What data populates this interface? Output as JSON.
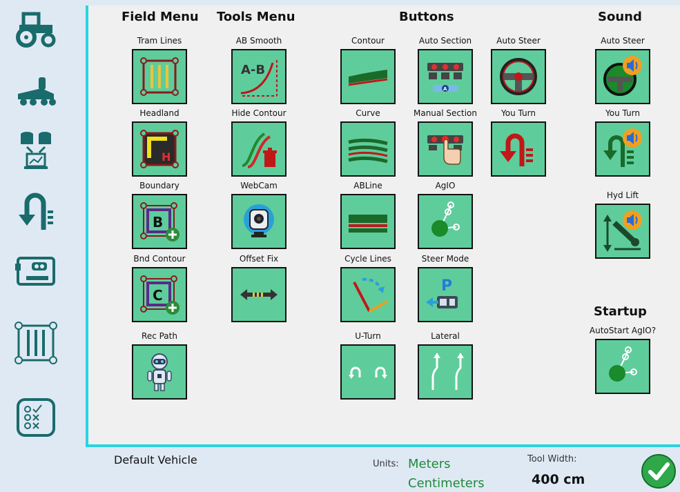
{
  "sidebar": {
    "items": [
      {
        "name": "vehicle"
      },
      {
        "name": "tool"
      },
      {
        "name": "data-sources"
      },
      {
        "name": "u-turn"
      },
      {
        "name": "arduino"
      },
      {
        "name": "tram"
      },
      {
        "name": "features"
      }
    ]
  },
  "sections": {
    "field_menu": "Field Menu",
    "tools_menu": "Tools Menu",
    "buttons": "Buttons",
    "sound": "Sound",
    "startup": "Startup"
  },
  "field_menu": {
    "tram_lines": "Tram Lines",
    "headland": "Headland",
    "boundary": "Boundary",
    "bnd_contour": "Bnd Contour",
    "rec_path": "Rec Path"
  },
  "tools_menu": {
    "ab_smooth": "AB Smooth",
    "hide_contour": "Hide Contour",
    "webcam": "WebCam",
    "offset_fix": "Offset Fix"
  },
  "buttons": {
    "contour": "Contour",
    "auto_section": "Auto Section",
    "auto_steer": "Auto Steer",
    "curve": "Curve",
    "manual_section": "Manual Section",
    "you_turn": "You Turn",
    "abline": "ABLine",
    "agio": "AgIO",
    "cycle_lines": "Cycle Lines",
    "steer_mode": "Steer Mode",
    "u_turn": "U-Turn",
    "lateral": "Lateral"
  },
  "sound": {
    "auto_steer": "Auto Steer",
    "you_turn": "You Turn",
    "hyd_lift": "Hyd Lift"
  },
  "startup": {
    "autostart_agio": "AutoStart AgIO?"
  },
  "footer": {
    "vehicle_name": "Default Vehicle",
    "units_label": "Units:",
    "units_primary": "Meters",
    "units_secondary": "Centimeters",
    "tool_width_label": "Tool Width:",
    "tool_width_value": "400 cm"
  },
  "colors": {
    "tile_green": "#5fcc9c",
    "accent_cyan": "#27d4e0",
    "icon_teal": "#1a6b6b",
    "ok_green": "#2ea84a"
  }
}
